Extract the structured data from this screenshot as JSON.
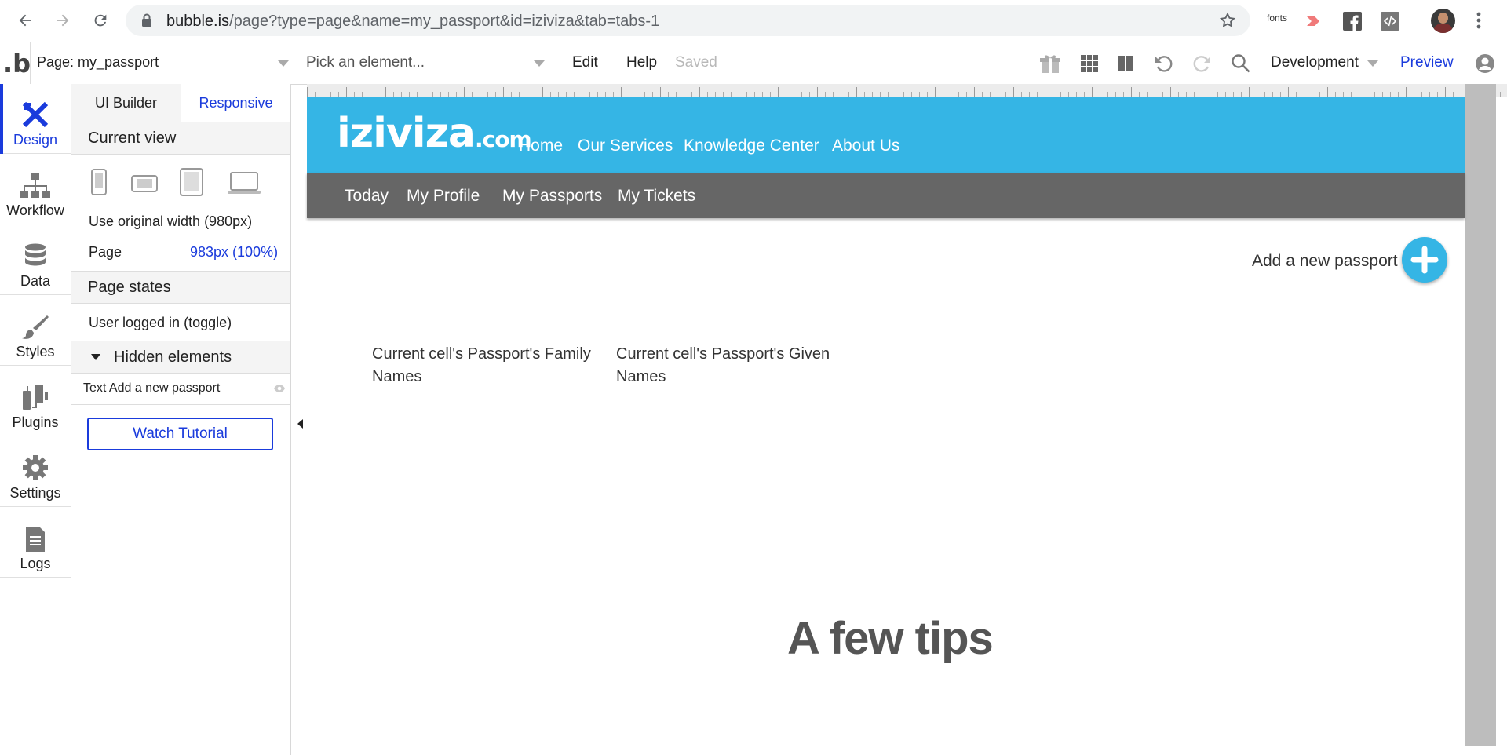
{
  "browser": {
    "url_host": "bubble.is",
    "url_path": "/page?type=page&name=my_passport&id=iziviza&tab=tabs-1",
    "ext_fonts_label": "fonts"
  },
  "editor": {
    "page_selector": "Page: my_passport",
    "element_picker": "Pick an element...",
    "menu_edit": "Edit",
    "menu_help": "Help",
    "saved_status": "Saved",
    "environment": "Development",
    "preview": "Preview"
  },
  "left_nav": {
    "items": [
      {
        "label": "Design",
        "icon": "design-icon"
      },
      {
        "label": "Workflow",
        "icon": "workflow-icon"
      },
      {
        "label": "Data",
        "icon": "database-icon"
      },
      {
        "label": "Styles",
        "icon": "brush-icon"
      },
      {
        "label": "Plugins",
        "icon": "plug-icon"
      },
      {
        "label": "Settings",
        "icon": "gear-icon"
      },
      {
        "label": "Logs",
        "icon": "document-icon"
      }
    ]
  },
  "panel": {
    "tab_ui_builder": "UI Builder",
    "tab_responsive": "Responsive",
    "current_view": "Current view",
    "use_original_width": "Use original width (980px)",
    "page_label": "Page",
    "page_width": "983px (100%)",
    "page_states": "Page states",
    "user_logged_in": "User logged in (toggle)",
    "hidden_elements": "Hidden elements",
    "hidden_item": "Text Add a new passport",
    "watch_tutorial": "Watch Tutorial"
  },
  "site": {
    "logo_main": "iziviza",
    "logo_domain": ".com",
    "nav": [
      "Home",
      "Our Services",
      "Knowledge Center",
      "About Us"
    ],
    "sub_nav": [
      "Today",
      "My Profile",
      "My Passports",
      "My Tickets"
    ],
    "add_passport": "Add a new passport",
    "cell_family": "Current cell's Passport's Family Names",
    "cell_given": "Current cell's Passport's Given Names",
    "tips_heading": "A few tips"
  },
  "colors": {
    "accent": "#1a3bdc",
    "site_header": "#35b5e5",
    "sub_nav": "#666666"
  }
}
